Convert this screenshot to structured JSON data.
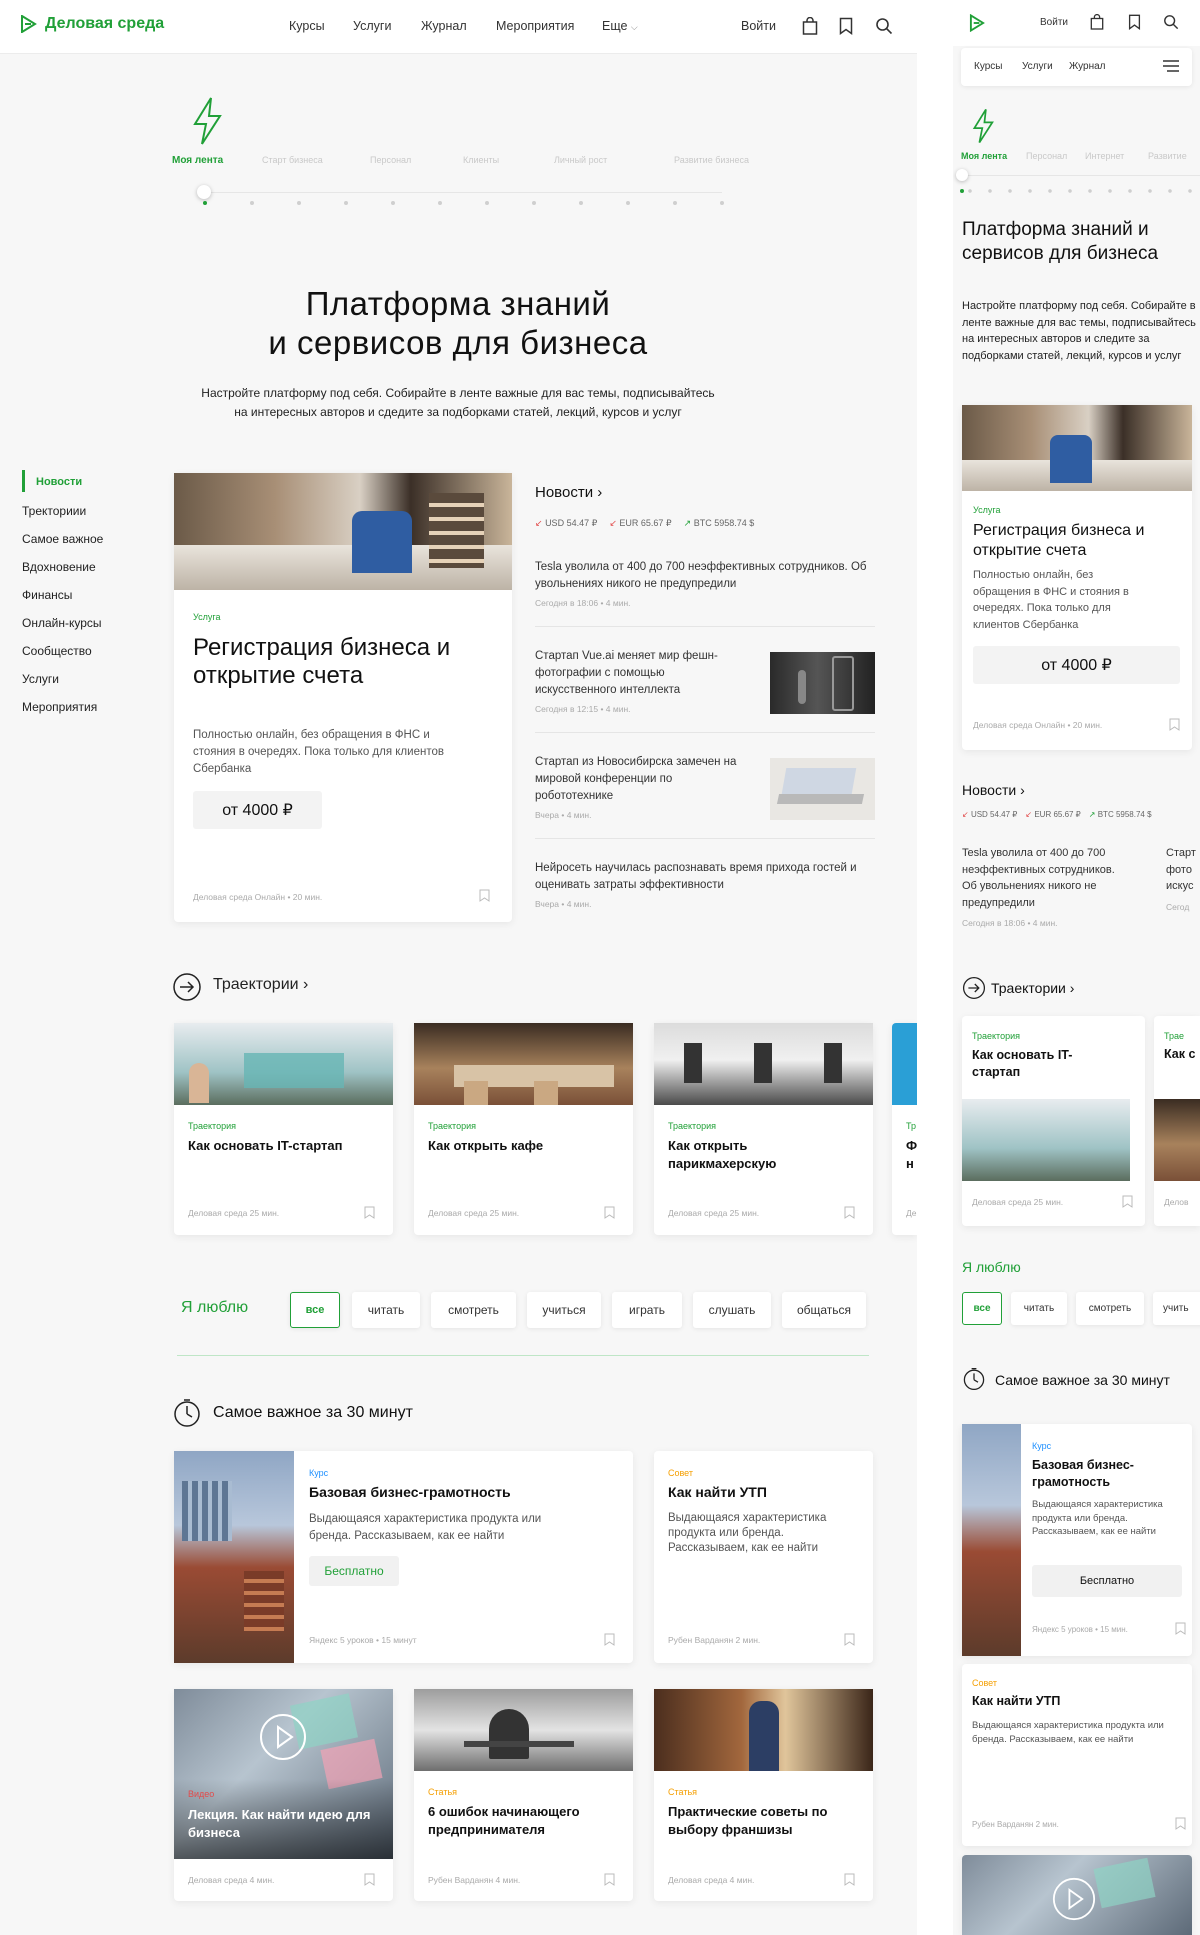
{
  "header": {
    "logo": "Деловая среда",
    "nav": [
      "Курсы",
      "Услуги",
      "Журнал",
      "Мероприятия",
      "Еще"
    ],
    "login": "Войти"
  },
  "mobile_header": {
    "login": "Войти",
    "nav": [
      "Курсы",
      "Услуги",
      "Журнал"
    ]
  },
  "feed_tabs": [
    "Моя лента",
    "Старт бизнеса",
    "Персонал",
    "Клиенты",
    "Личный рост",
    "Развитие бизнеса"
  ],
  "mobile_feed_tabs": [
    "Моя лента",
    "Персонал",
    "Интернет",
    "Развитие"
  ],
  "hero": {
    "title_line1": "Платформа знаний",
    "title_line2": "и сервисов для бизнеса",
    "subtitle_line1": "Настройте платформу под себя. Собирайте в ленте важные для вас темы, подписывайтесь",
    "subtitle_line2": "на интересных авторов и сдeдите за подборками статей, лекций, курсов и услуг"
  },
  "mobile_hero": {
    "title": "Платформа знаний и сервисов для бизнеса",
    "subtitle": "Настройте платформу под себя. Собирайте в ленте важные для вас темы, подписывайтесь на интересных авторов и следите за подборками статей, лекций, курсов и услуг"
  },
  "sidebar": [
    "Новости",
    "Тректориии",
    "Самое важное",
    "Вдохновение",
    "Финансы",
    "Онлайн-курсы",
    "Сообщество",
    "Услуги",
    "Мероприятия"
  ],
  "service": {
    "tag": "Услуга",
    "title": "Регистрация бизнеса и открытие счета",
    "desc": "Полностью онлайн, без обращения в ФНС и стояния в очередях. Пока только для клиентов Сбербанка",
    "price": "от 4000 ₽",
    "meta": "Деловая среда    Онлайн • 20 мин."
  },
  "news": {
    "title": "Новости ›",
    "rates": [
      "USD 54.47 ₽",
      "EUR 65.67 ₽",
      "BTC 5958.74 $"
    ],
    "items": [
      {
        "text": "Tesla уволила от 400 до 700 неэффективных сотрудников. Об увольнениях никого не предупредили",
        "meta": "Сегодня в 18:06 • 4 мин."
      },
      {
        "text": "Стартап Vue.ai меняет мир фешн-фотографии с помощью искусственного интеллекта",
        "meta": "Сегодня в 12:15 • 4 мин."
      },
      {
        "text": "Стартап из Новосибирска замечен на мировой конференции по робототехнике",
        "meta": "Вчера • 4 мин."
      },
      {
        "text": "Нейросеть научилась распознавать время прихода гостей и оценивать затраты эффективности",
        "meta": "Вчера • 4 мин."
      }
    ]
  },
  "mobile_news": {
    "text": "Tesla уволила от 400 до 700 неэффективных сотрудников. Об увольнениях никого не предупредили",
    "meta": "Сегодня в 18:06 • 4 мин.",
    "peek": "Старт фото искус",
    "peek_meta": "Сегод"
  },
  "trajectories": {
    "title": "Траектории ›",
    "items": [
      {
        "tag": "Траектория",
        "title": "Как основать IT-стартап",
        "meta": "Деловая среда    25 мин."
      },
      {
        "tag": "Траектория",
        "title": "Как открыть кафе",
        "meta": "Деловая среда    25 мин."
      },
      {
        "tag": "Траектория",
        "title": "Как открыть парикмахерскую",
        "meta": "Деловая среда    25 мин."
      }
    ],
    "peek": {
      "tag": "Тр",
      "title": "Ф н",
      "meta": "Де"
    }
  },
  "mobile_traj": {
    "tag": "Траектория",
    "title": "Как основать IT-стартап",
    "meta": "Деловая среда    25 мин.",
    "peek_tag": "Трае",
    "peek_title": "Как с",
    "peek_meta": "Делов"
  },
  "ilike": {
    "title": "Я люблю",
    "chips": [
      "все",
      "читать",
      "смотреть",
      "учиться",
      "играть",
      "слушать",
      "общаться"
    ],
    "mobile_chips": [
      "все",
      "читать",
      "смотреть",
      "учить"
    ]
  },
  "important": {
    "title": "Самое важное за 30 минут",
    "mobile_title": "Самое важное за 30 минут",
    "items": [
      {
        "tag": "Курс",
        "title": "Базовая бизнес-грамотность",
        "desc": "Выдающаяся характеристика продукта или бренда. Рассказываем, как ее найти",
        "button": "Бесплатно",
        "meta": "Яндекс    5 уроков • 15 минут"
      },
      {
        "tag": "Совет",
        "title": "Как найти УТП",
        "desc": "Выдающаяся характеристика продукта или бренда. Рассказываем, как ее найти",
        "meta": "Рубен Варданян    2 мин."
      },
      {
        "tag": "Видео",
        "title": "Лекция. Как найти идею для бизнеса",
        "meta": "Деловая среда    4 мин."
      },
      {
        "tag": "Статья",
        "title": "6 ошибок начинающего предпринимателя",
        "meta": "Рубен Варданян    4 мин."
      },
      {
        "tag": "Статья",
        "title": "Практические советы по выбору франшизы",
        "meta": "Деловая среда    4 мин."
      }
    ],
    "mobile_meta1": "Яндекс    5 уроков • 15 мин."
  },
  "colors": {
    "accent": "#21a038",
    "orange": "#f59f00",
    "red": "#e24b4b"
  }
}
